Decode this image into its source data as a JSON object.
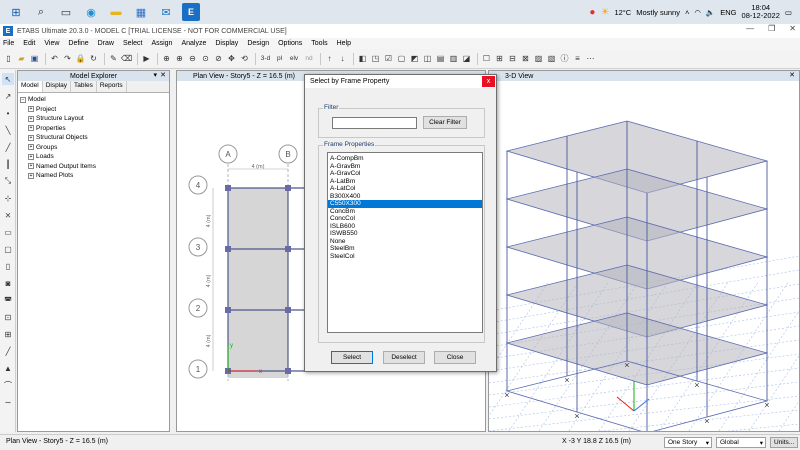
{
  "taskbar": {
    "icons": [
      "windows-icon",
      "search-icon",
      "task-view-icon",
      "edge-icon",
      "file-explorer-icon",
      "store-icon",
      "mail-icon",
      "etabs-icon"
    ],
    "weather_temp": "12°C",
    "weather_text": "Mostly sunny",
    "language": "ENG",
    "time": "18:04",
    "date": "08-12-2022"
  },
  "window": {
    "title": "ETABS Ultimate 20.3.0 - MODEL C  [TRIAL LICENSE - NOT FOR COMMERCIAL USE]"
  },
  "menu": [
    "File",
    "Edit",
    "View",
    "Define",
    "Draw",
    "Select",
    "Assign",
    "Analyze",
    "Display",
    "Design",
    "Options",
    "Tools",
    "Help"
  ],
  "toolbar": {
    "label_3d": "3-d",
    "label_pl": "pl",
    "label_elv": "elv",
    "label_nd": "nd"
  },
  "explorer": {
    "title": "Model Explorer",
    "tabs": [
      "Model",
      "Display",
      "Tables",
      "Reports"
    ],
    "root": "Model",
    "items": [
      "Project",
      "Structure Layout",
      "Properties",
      "Structural Objects",
      "Groups",
      "Loads",
      "Named Output Items",
      "Named Plots"
    ]
  },
  "plan_view": {
    "title": "Plan View - Story5 - Z = 16.5 (m)",
    "col_labels": [
      "A",
      "B"
    ],
    "row_labels": [
      "4",
      "3",
      "2",
      "1"
    ],
    "dim_top": "4 (m)",
    "dim_side": [
      "4 (m)",
      "4 (m)",
      "4 (m)"
    ]
  },
  "view3d": {
    "title": "3-D View"
  },
  "dialog": {
    "title": "Select by Frame Property",
    "close": "x",
    "filter_label": "Filter",
    "filter_value": "",
    "clear_filter": "Clear Filter",
    "list_label": "Frame Properties",
    "items": [
      "A-CompBm",
      "A-GravBm",
      "A-GravCol",
      "A-LatBm",
      "A-LatCol",
      "B300X400",
      "C550X300",
      "ConcBm",
      "ConcCol",
      "ISLB600",
      "ISWB550",
      "None",
      "SteelBm",
      "SteelCol"
    ],
    "selected_index": 6,
    "select": "Select",
    "deselect": "Deselect",
    "close_btn": "Close"
  },
  "status": {
    "left": "Plan View - Story5 - Z = 16.5 (m)",
    "coords": "X -3  Y 18.8  Z 16.5 (m)",
    "story": "One Story",
    "coord_sys": "Global",
    "units": "Units..."
  },
  "colors": {
    "selection": "#0078d7",
    "grid_node": "#6a6aa8",
    "axis_red": "#e02020",
    "axis_green": "#10b010",
    "accent": "#1a6fc4"
  }
}
